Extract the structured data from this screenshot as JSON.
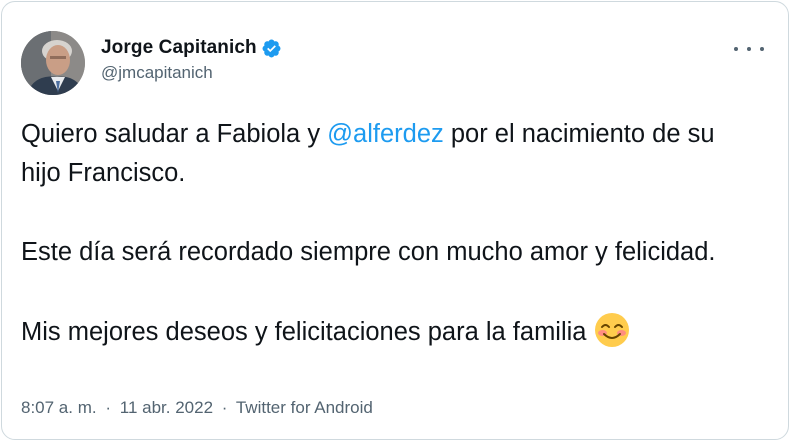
{
  "author": {
    "display_name": "Jorge Capitanich",
    "handle": "@jmcapitanich",
    "verified": true,
    "avatar_icon": "profile-photo"
  },
  "tweet": {
    "line1_before": "Quiero saludar a Fabiola y ",
    "mention": "@alferdez",
    "line1_after": " por el nacimiento de su hijo Francisco.",
    "paragraph2": "Este día será recordado siempre con mucho amor y felicidad.",
    "paragraph3": "Mis mejores deseos y felicitaciones para la familia",
    "emoji": "smiling-face-with-smiling-eyes"
  },
  "meta": {
    "time": "8:07 a. m.",
    "separator1": "·",
    "date": "11 abr. 2022",
    "separator2": "·",
    "source": "Twitter for Android"
  },
  "colors": {
    "link": "#1d9bf0",
    "secondary_text": "#536471",
    "primary_text": "#0f1419",
    "border": "#cfd9de",
    "verified_badge": "#1d9bf0"
  },
  "icons": {
    "more": "more-horizontal-icon",
    "verified": "verified-badge-icon"
  }
}
